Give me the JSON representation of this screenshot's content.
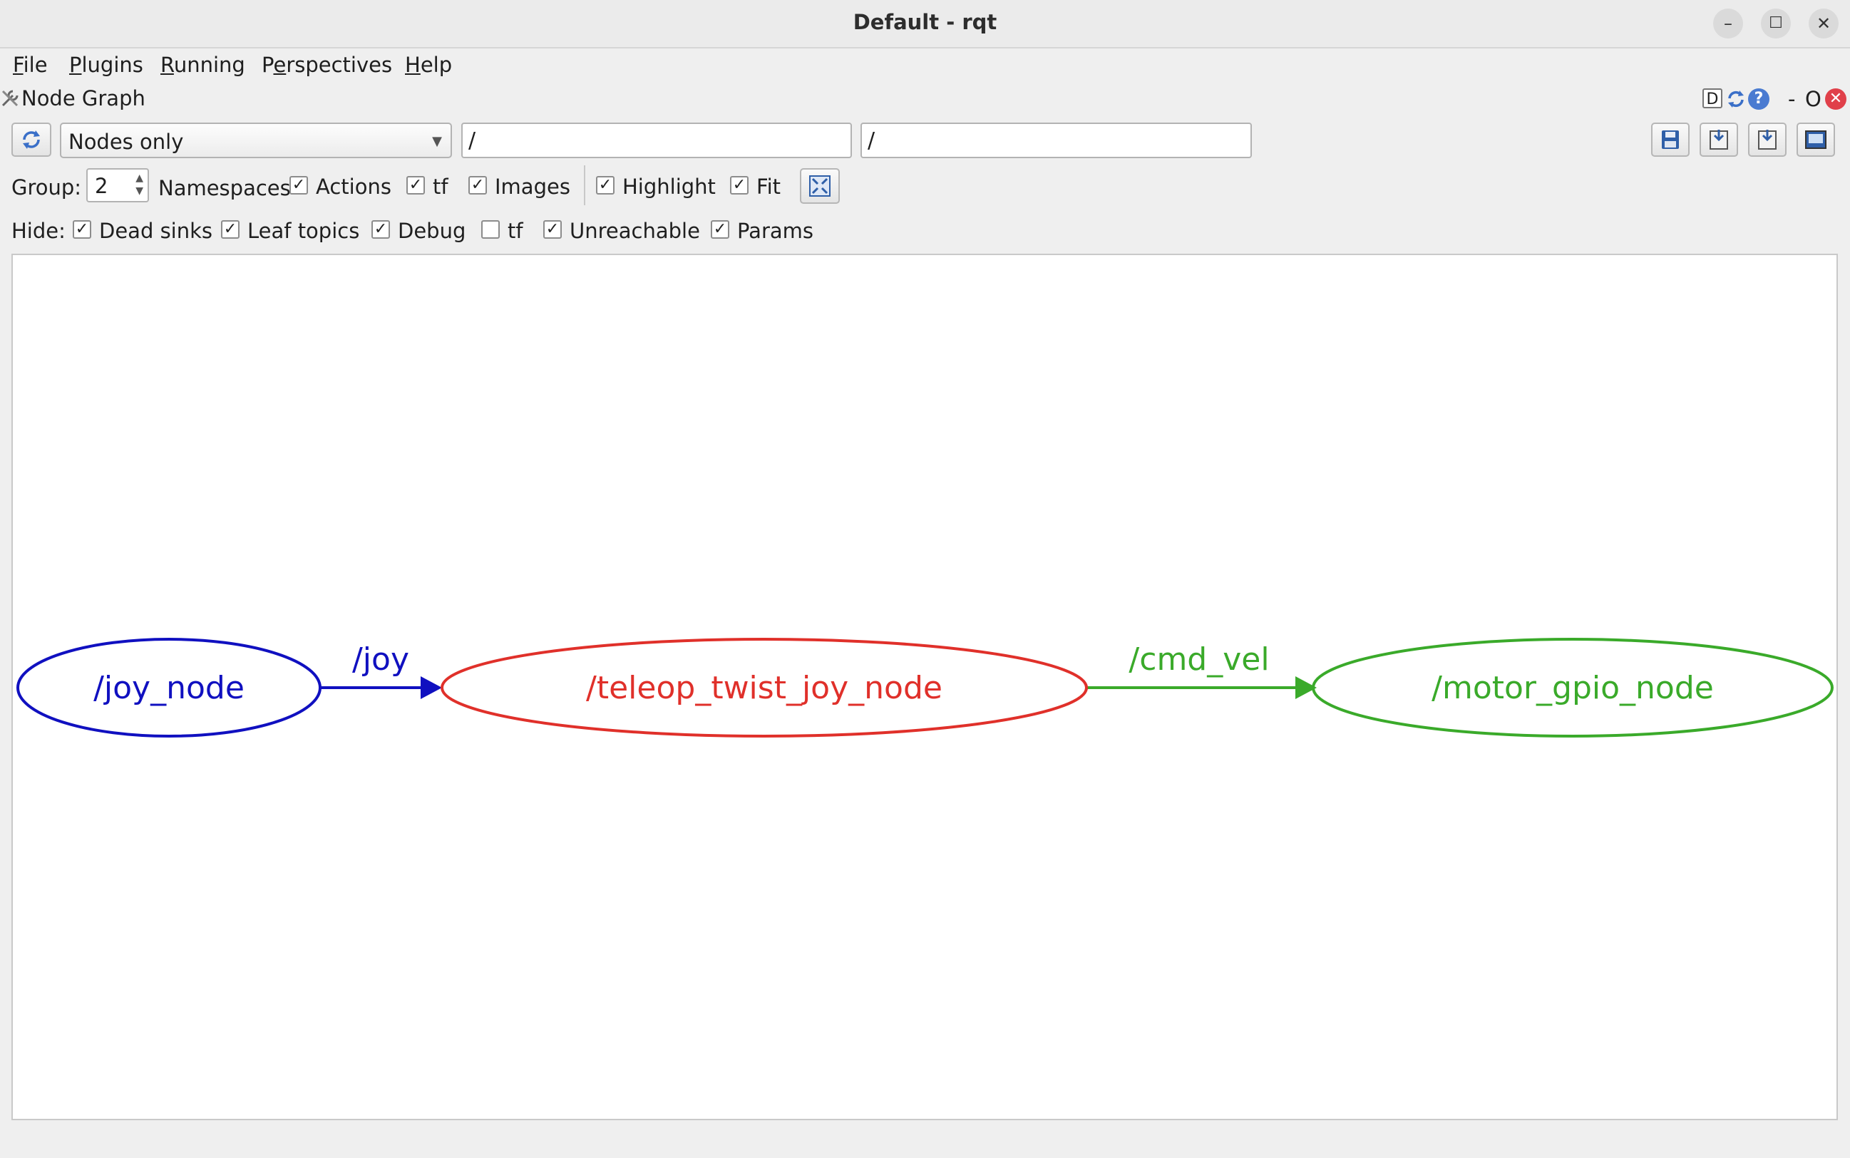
{
  "window": {
    "title": "Default - rqt",
    "minimize_glyph": "–",
    "maximize_glyph": "☐",
    "close_glyph": "✕"
  },
  "menu": [
    {
      "underline": "F",
      "rest": "ile"
    },
    {
      "underline": "P",
      "rest": "lugins"
    },
    {
      "underline": "R",
      "rest": "unning"
    },
    {
      "prefix": "P",
      "underline": "e",
      "rest": "rspectives"
    },
    {
      "underline": "H",
      "rest": "elp"
    }
  ],
  "plugin": {
    "title": "Node Graph",
    "d_label": "D",
    "help_label": "?",
    "minimize_label": "-",
    "float_label": "O",
    "close_label": "✕"
  },
  "toolbar": {
    "graph_mode": "Nodes only",
    "node_filter": "/",
    "topic_filter": "/"
  },
  "group_row": {
    "group_label": "Group:",
    "group_value": "2",
    "options": [
      {
        "label": "Namespaces",
        "checked": true
      },
      {
        "label": "Actions",
        "checked": true
      },
      {
        "label": "tf",
        "checked": true
      },
      {
        "label": "Images",
        "checked": false
      },
      {
        "label": "Highlight",
        "checked": true
      },
      {
        "label": "Fit",
        "checked": true
      }
    ]
  },
  "hide_row": {
    "hide_label": "Hide:",
    "options": [
      {
        "label": "Dead sinks",
        "checked": true
      },
      {
        "label": "Leaf topics",
        "checked": true
      },
      {
        "label": "Debug",
        "checked": true
      },
      {
        "label": "tf",
        "checked": false
      },
      {
        "label": "Unreachable",
        "checked": true
      },
      {
        "label": "Params",
        "checked": true
      }
    ]
  },
  "graph": {
    "nodes": [
      {
        "name": "/joy_node",
        "color": "#1010c0"
      },
      {
        "name": "/teleop_twist_joy_node",
        "color": "#e0302a"
      },
      {
        "name": "/motor_gpio_node",
        "color": "#3aaa2a"
      }
    ],
    "edges": [
      {
        "topic": "/joy",
        "from": 0,
        "to": 1,
        "color": "#1010c0"
      },
      {
        "topic": "/cmd_vel",
        "from": 1,
        "to": 2,
        "color": "#3aaa2a"
      }
    ]
  }
}
